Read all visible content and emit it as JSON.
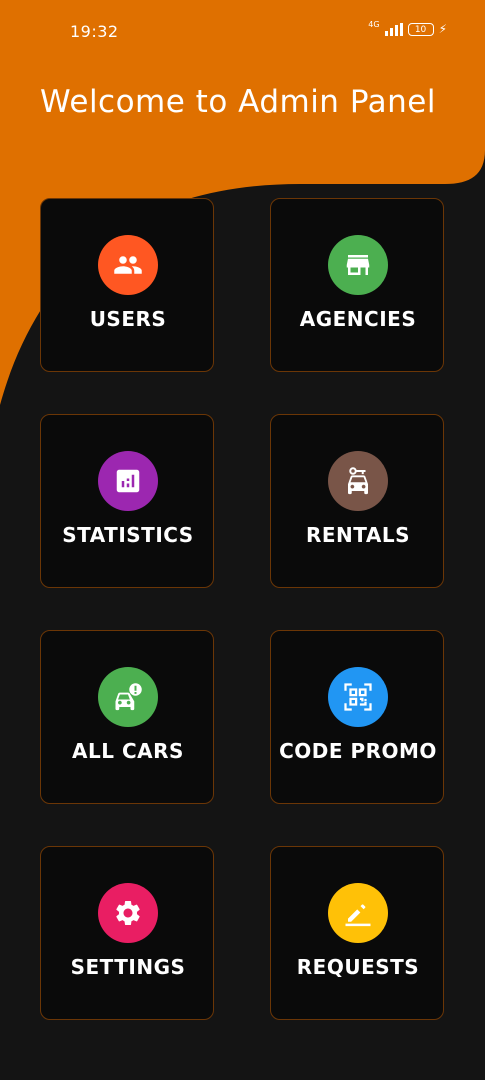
{
  "status_bar": {
    "time": "19:32",
    "network": "4G",
    "battery": "10"
  },
  "header": {
    "title": "Welcome to Admin Panel"
  },
  "colors": {
    "accent": "#DF7000",
    "background": "#141414",
    "card": "#0A0A0A",
    "card_border": "#6B3606"
  },
  "menu": [
    {
      "label": "USERS",
      "icon": "users-icon",
      "color": "#FF5722"
    },
    {
      "label": "AGENCIES",
      "icon": "store-icon",
      "color": "#4CAF50"
    },
    {
      "label": "STATISTICS",
      "icon": "chart-icon",
      "color": "#9C27B0"
    },
    {
      "label": "RENTALS",
      "icon": "car-key-icon",
      "color": "#795548"
    },
    {
      "label": "ALL CARS",
      "icon": "car-alert-icon",
      "color": "#4CAF50"
    },
    {
      "label": "CODE PROMO",
      "icon": "qr-scan-icon",
      "color": "#2196F3"
    },
    {
      "label": "SETTINGS",
      "icon": "gear-icon",
      "color": "#E91E63"
    },
    {
      "label": "REQUESTS",
      "icon": "pencil-icon",
      "color": "#FFC107"
    }
  ]
}
